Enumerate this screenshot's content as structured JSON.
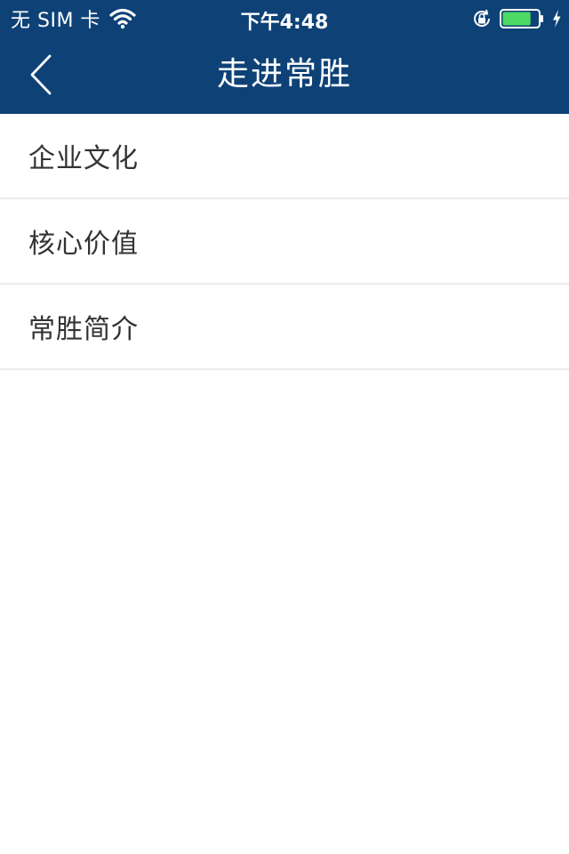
{
  "status_bar": {
    "carrier": "无 SIM 卡",
    "time": "下午4:48",
    "icons": [
      "wifi-icon",
      "rotation-lock-icon",
      "battery-icon",
      "charging-bolt-icon"
    ],
    "battery_level": 0.8
  },
  "nav": {
    "title": "走进常胜",
    "back_icon": "chevron-left-icon"
  },
  "menu": {
    "items": [
      {
        "label": "企业文化"
      },
      {
        "label": "核心价值"
      },
      {
        "label": "常胜简介"
      }
    ]
  },
  "colors": {
    "header_bg": "#0e4277",
    "battery_fill": "#4cd964",
    "divider": "#ececec",
    "item_text": "#333333"
  }
}
